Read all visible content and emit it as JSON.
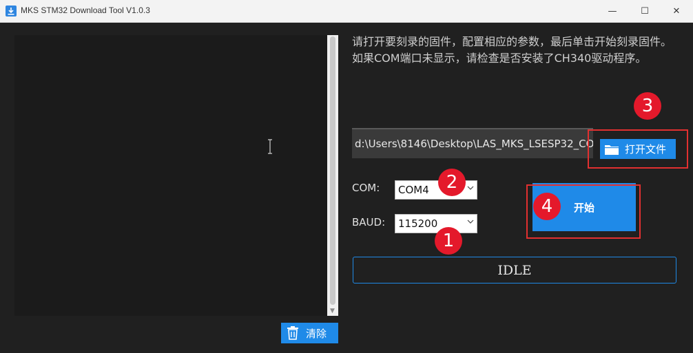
{
  "window": {
    "title": "MKS STM32 Download Tool V1.0.3",
    "minimize_glyph": "—",
    "maximize_glyph": "☐",
    "close_glyph": "✕"
  },
  "log_panel": {
    "scroll_down_glyph": "▼"
  },
  "clear_button": {
    "label": "清除",
    "icon": "trash-icon"
  },
  "instructions": "请打开要刻录的固件，配置相应的参数，最后单击开始刻录固件。如果COM端口未显示，请检查是否安装了CH340驱动程序。",
  "firmware_path": "d:\\Users\\8146\\Desktop\\LAS_MKS_LSESP32_CO",
  "open_file_button": {
    "label": "打开文件",
    "icon": "folder-icon"
  },
  "com": {
    "label": "COM:",
    "value": "COM4"
  },
  "baud": {
    "label": "BAUD:",
    "value": "115200"
  },
  "start_button": {
    "label": "开始"
  },
  "status": "IDLE",
  "annotations": {
    "step1": "1",
    "step2": "2",
    "step3": "3",
    "step4": "4"
  },
  "colors": {
    "accent": "#1f8ae8",
    "annotation_red": "#e4192b",
    "background": "#202020"
  }
}
